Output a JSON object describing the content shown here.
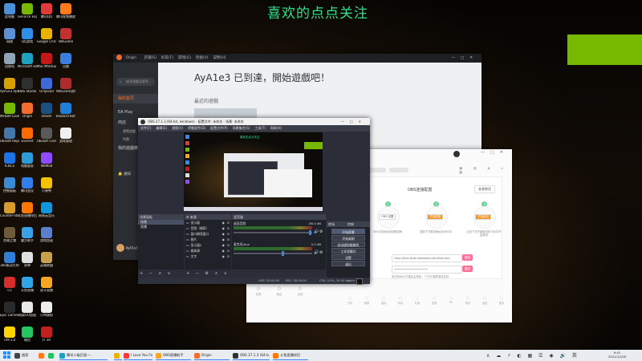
{
  "overlay_title": "喜欢的点点关注",
  "desktop_icons": [
    {
      "label": "此电脑",
      "color": "#4a90d9"
    },
    {
      "label": "GeForce Experience",
      "color": "#76b900"
    },
    {
      "label": "腾讯QQ",
      "color": "#e03a3a"
    },
    {
      "label": "腾讯视频播放器",
      "color": "#ff7a1a"
    },
    {
      "label": "网络",
      "color": "#5d8fd6"
    },
    {
      "label": "QQ游戏",
      "color": "#2f8fe8"
    },
    {
      "label": "Google Chrome",
      "color": "#e8b200"
    },
    {
      "label": "WeGame",
      "color": "#c42f2f"
    },
    {
      "label": "回收站",
      "color": "#8fa4b8"
    },
    {
      "label": "Microsoft Edge",
      "color": "#1da1c1"
    },
    {
      "label": "MSI Afterburner",
      "color": "#c41818"
    },
    {
      "label": "迅雷",
      "color": "#3a7ee0"
    },
    {
      "label": "AyA1e3 Apk",
      "color": "#d6a000"
    },
    {
      "label": "OBS Studio",
      "color": "#303030"
    },
    {
      "label": "Onlyload",
      "color": "#3d6ad6"
    },
    {
      "label": "WeGame游戏",
      "color": "#b02b2b"
    },
    {
      "label": "NVIDIA Gaimer",
      "color": "#76b900"
    },
    {
      "label": "Origin",
      "color": "#f56c2d"
    },
    {
      "label": "Steam",
      "color": "#1b4f80"
    },
    {
      "label": "Blizzard Battle",
      "color": "#1e7fd8"
    },
    {
      "label": "Ubisoft Repair",
      "color": "#4477aa"
    },
    {
      "label": "Everest",
      "color": "#ff6a00"
    },
    {
      "label": "Ubisoft Connect",
      "color": "#5a5a5a"
    },
    {
      "label": "游戏管理",
      "color": "#f0f0f0"
    },
    {
      "label": "ICBCS",
      "color": "#1a73e8"
    },
    {
      "label": "电脑管家",
      "color": "#2d9cdb"
    },
    {
      "label": "WeMod",
      "color": "#8f4cff"
    },
    {
      "label": "",
      "color": ""
    },
    {
      "label": "控制面板",
      "color": "#3a8ad6"
    },
    {
      "label": "腾讯会议",
      "color": "#2f80ed"
    },
    {
      "label": "小黄鸭",
      "color": "#f2c200"
    },
    {
      "label": "",
      "color": ""
    },
    {
      "label": "Counter-Strike Global Off",
      "color": "#d99b2b"
    },
    {
      "label": "斗鱼直播伴侣",
      "color": "#ff7700"
    },
    {
      "label": "网易云音乐",
      "color": "#1296db"
    },
    {
      "label": "",
      "color": ""
    },
    {
      "label": "黑暗之魂",
      "color": "#6d5a3a"
    },
    {
      "label": "魔方助手",
      "color": "#3aa0e8"
    },
    {
      "label": "游戏加速",
      "color": "#5b7fc9"
    },
    {
      "label": "",
      "color": ""
    },
    {
      "label": "360驱动大师",
      "color": "#2f7ed8"
    },
    {
      "label": "原神",
      "color": "#e0e0e0"
    },
    {
      "label": "英雄联盟",
      "color": "#c8a24a"
    },
    {
      "label": "",
      "color": ""
    },
    {
      "label": "C5",
      "color": "#d62d2d"
    },
    {
      "label": "斗鱼直播",
      "color": "#2fa4e7"
    },
    {
      "label": "虎牙直播",
      "color": "#f5a623"
    },
    {
      "label": "",
      "color": ""
    },
    {
      "label": "Epic Games Launcher",
      "color": "#2a2a2a"
    },
    {
      "label": "网易UU加速",
      "color": "#e8e8e8"
    },
    {
      "label": "小鸡模拟",
      "color": "#eeeeee"
    },
    {
      "label": "",
      "color": ""
    },
    {
      "label": "TIM 3.0",
      "color": "#ffd400"
    },
    {
      "label": "微信",
      "color": "#22c55e"
    },
    {
      "label": "FI 3A",
      "color": "#c21f1f"
    },
    {
      "label": "",
      "color": ""
    }
  ],
  "origin": {
    "app_name": "Origin",
    "menu": [
      "店铺(S)",
      "好友(F)",
      "游戏(G)",
      "检视(V)",
      "说明(H)"
    ],
    "search_placeholder": "搜寻遊戲及更多",
    "nav_items": [
      "我的首頁",
      "EA Play",
      "商店",
      "瀏覽遊戲",
      "特賣",
      "我的遊戲庫"
    ],
    "notifications_label": "通知",
    "username": "AyA1e3",
    "welcome": "AyA1e3 已到達，開始遊戲吧！",
    "recent_games_label": "最近的遊戲"
  },
  "obs": {
    "title": "OBS 27.1.3 (64-bit, windows) - 配置文件: 未命名 - 场景: 未命名",
    "menu": [
      "文件(F)",
      "编辑(E)",
      "视图(V)",
      "停靠部件(D)",
      "配置文件(P)",
      "场景集合(S)",
      "工具(T)",
      "帮助(H)"
    ],
    "docks": {
      "scenes": "场景面板",
      "sources": "来源",
      "mixer": "混音器",
      "transitions": "转场",
      "controls": "控制"
    },
    "scenes": [
      "场景",
      "直播"
    ],
    "sources": [
      "显示器",
      "音频（捕获）",
      "窗口捕获窗口",
      "图片",
      "显示器2",
      "媒体源",
      "文字"
    ],
    "mixer": [
      {
        "name": "桌面音频",
        "db": "-60.0 dB"
      },
      {
        "name": "麦克风/Aux",
        "db": "0.0 dB"
      }
    ],
    "controls": [
      "开始直播",
      "开始录制",
      "启动虚拟摄像机",
      "工作室模式",
      "设置",
      "退出"
    ],
    "status": {
      "live": "LIVE: 00:00:00",
      "rec": "REC: 00:00:00",
      "cpu": "CPU: 0.9%, 30.00 fps",
      "kbps": "kb/s: 0"
    },
    "transition_value": "淡入淡出",
    "transition_duration": "时长 300 ms"
  },
  "assistant": {
    "title": "OBS直播助手",
    "step_label": "OBS连接配置",
    "step_button": "查看教程",
    "steps": [
      {
        "num": "1",
        "label": "OBS 设置",
        "desc": "OBS已将地址填到推流码",
        "tag": "OBS 设置"
      },
      {
        "num": "2",
        "label": "开始直播",
        "desc": "复制下方推流地址到OBS中",
        "tag": "开始直播"
      },
      {
        "num": "3",
        "label": "开始推流",
        "desc": "点击下方开始推流在OBS中开启推流",
        "tag": "开始推流"
      }
    ],
    "server_value": "rtmp://live-push.bilivideo.com/live-bvc/",
    "key_value": "••••••••••••••••••••",
    "copy_label": "复制",
    "note": "推流码每次开播后会更新，下次开播需重新复制",
    "toolbar": [
      "分享",
      "美颜",
      "道具",
      "特效",
      "礼物",
      "连麦",
      "PK",
      "音乐",
      "贴纸",
      "更多"
    ],
    "bottom_icons": [
      "礼物",
      "粉丝",
      "互动"
    ]
  },
  "taskbar": {
    "items": [
      {
        "label": "搜索",
        "color": "#444"
      },
      {
        "label": "斗鱼",
        "color": "#ff7a1a"
      },
      {
        "label": "微信",
        "color": "#22c55e"
      },
      {
        "label": "腾讯二级页面一..",
        "color": "#1da1c1"
      },
      {
        "label": "Chrome",
        "color": "#e8b200"
      },
      {
        "label": "I Love You Foreve",
        "color": "#f23a3a"
      },
      {
        "label": "OBS直播助手",
        "color": "#f5a623"
      },
      {
        "label": "Origin",
        "color": "#f56c2d"
      },
      {
        "label": "OBS 27.1.3 (64-b..",
        "color": "#303030"
      },
      {
        "label": "斗鱼直播伴侣",
        "color": "#ff7700"
      }
    ],
    "time": "9:41",
    "date": "2021/12/28"
  }
}
